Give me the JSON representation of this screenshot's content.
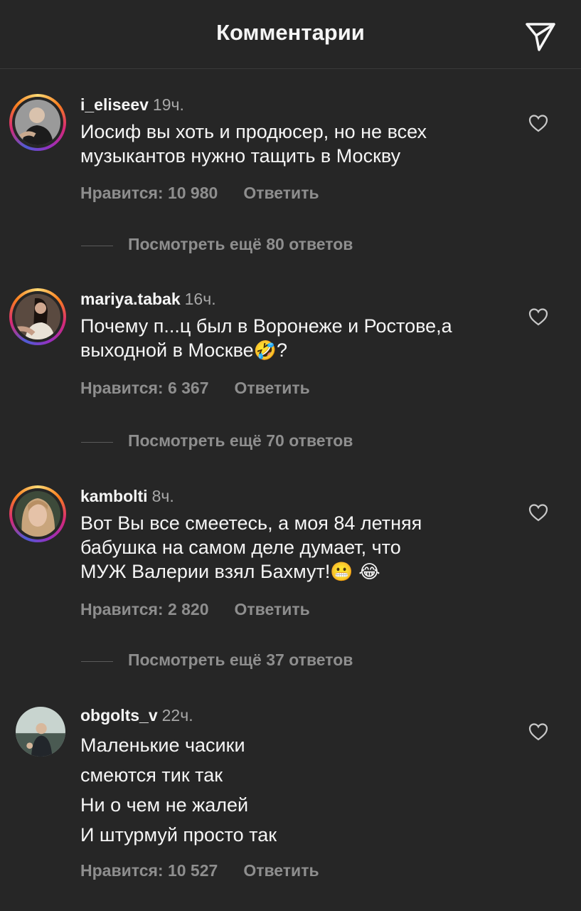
{
  "header": {
    "title": "Комментарии",
    "share_icon": "paper-plane-icon"
  },
  "colors": {
    "background": "#262626",
    "text": "#f5f5f5",
    "muted": "#8e8e8e"
  },
  "comments": [
    {
      "username": "i_eliseev",
      "time": "19ч.",
      "lines": [
        "Иосиф вы хоть и продюсер, но не всех",
        "музыкантов нужно тащить в Москву"
      ],
      "likes": "Нравится: 10 980",
      "reply": "Ответить",
      "more": "Посмотреть ещё 80 ответов"
    },
    {
      "username": "mariya.tabak",
      "time": "16ч.",
      "lines": [
        "Почему п...ц был в Воронеже и Ростове,а",
        "выходной в Москве",
        "?"
      ],
      "emojis": [
        "🤣"
      ],
      "likes": "Нравится: 6 367",
      "reply": "Ответить",
      "more": "Посмотреть ещё 70 ответов"
    },
    {
      "username": "kambolti",
      "time": "8ч.",
      "lines": [
        "Вот Вы все смеетесь, а моя 84 летняя",
        "бабушка на самом деле думает, что",
        "МУЖ Валерии взял Бахмут!"
      ],
      "emojis": [
        "😬",
        "😂"
      ],
      "likes": "Нравится: 2 820",
      "reply": "Ответить",
      "more": "Посмотреть ещё 37 ответов"
    },
    {
      "username": "obgolts_v",
      "time": "22ч.",
      "lines": [
        "Маленькие часики",
        "смеются тик так",
        "Ни о чем не жалей",
        "И штурмуй просто так"
      ],
      "likes": "Нравится: 10 527",
      "reply": "Ответить"
    }
  ]
}
